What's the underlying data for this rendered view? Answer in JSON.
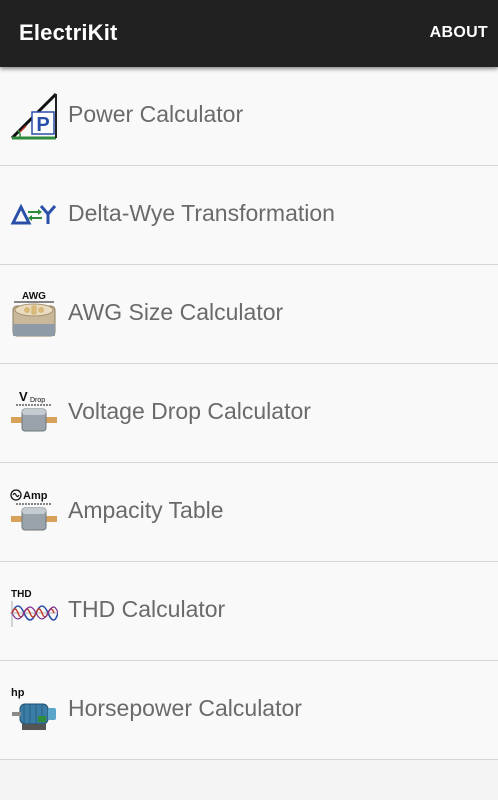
{
  "app_bar": {
    "title": "ElectriKit",
    "about_label": "ABOUT"
  },
  "menu": {
    "items": [
      {
        "label": "Power Calculator",
        "icon": "power-triangle-icon"
      },
      {
        "label": "Delta-Wye Transformation",
        "icon": "delta-wye-icon"
      },
      {
        "label": "AWG Size Calculator",
        "icon": "awg-cable-icon"
      },
      {
        "label": "Voltage Drop Calculator",
        "icon": "voltage-drop-icon"
      },
      {
        "label": "Ampacity Table",
        "icon": "ampacity-icon"
      },
      {
        "label": "THD Calculator",
        "icon": "thd-waveform-icon"
      },
      {
        "label": "Horsepower Calculator",
        "icon": "motor-icon"
      }
    ]
  },
  "icon_text": {
    "power": "P",
    "awg": "AWG",
    "vdrop_v": "V",
    "vdrop_sub": "Drop",
    "amp": "Amp",
    "thd": "THD",
    "hp": "hp"
  },
  "colors": {
    "app_bar": "#212121",
    "app_bar_text": "#ffffff",
    "list_background": "#f9f9f9",
    "divider": "#d6d6d6",
    "item_text": "#6a6a6a"
  }
}
